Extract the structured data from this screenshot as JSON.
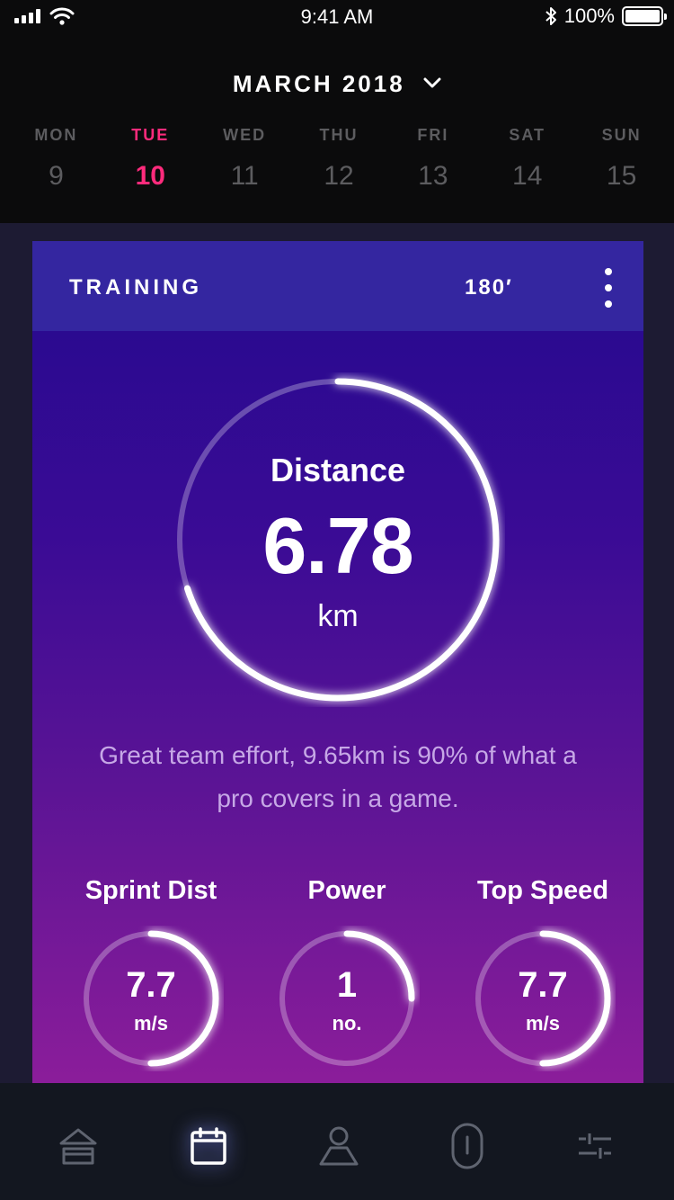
{
  "status_bar": {
    "time": "9:41 AM",
    "battery_text": "100%",
    "battery_level": 1.0
  },
  "calendar": {
    "month_title": "MARCH 2018",
    "days": [
      {
        "name": "MON",
        "number": "9",
        "active": false
      },
      {
        "name": "TUE",
        "number": "10",
        "active": true
      },
      {
        "name": "WED",
        "number": "11",
        "active": false
      },
      {
        "name": "THU",
        "number": "12",
        "active": false
      },
      {
        "name": "FRI",
        "number": "13",
        "active": false
      },
      {
        "name": "SAT",
        "number": "14",
        "active": false
      },
      {
        "name": "SUN",
        "number": "15",
        "active": false
      }
    ],
    "active_color": "#ff2b7c"
  },
  "card": {
    "title": "TRAINING",
    "duration": "180′",
    "distance": {
      "label": "Distance",
      "value": "6.78",
      "unit": "km",
      "progress": 0.7
    },
    "message": "Great team effort, 9.65km is 90% of what a pro covers in a game.",
    "stats": [
      {
        "label": "Sprint Dist",
        "value": "7.7",
        "unit": "m/s",
        "progress": 0.5
      },
      {
        "label": "Power",
        "value": "1",
        "unit": "no.",
        "progress": 0.25
      },
      {
        "label": "Top Speed",
        "value": "7.7",
        "unit": "m/s",
        "progress": 0.5
      }
    ]
  },
  "bottom_nav": {
    "items": [
      {
        "icon": "home-icon",
        "active": false
      },
      {
        "icon": "calendar-icon",
        "active": true
      },
      {
        "icon": "profile-icon",
        "active": false
      },
      {
        "icon": "tracker-device-icon",
        "active": false
      },
      {
        "icon": "settings-sliders-icon",
        "active": false
      }
    ]
  }
}
